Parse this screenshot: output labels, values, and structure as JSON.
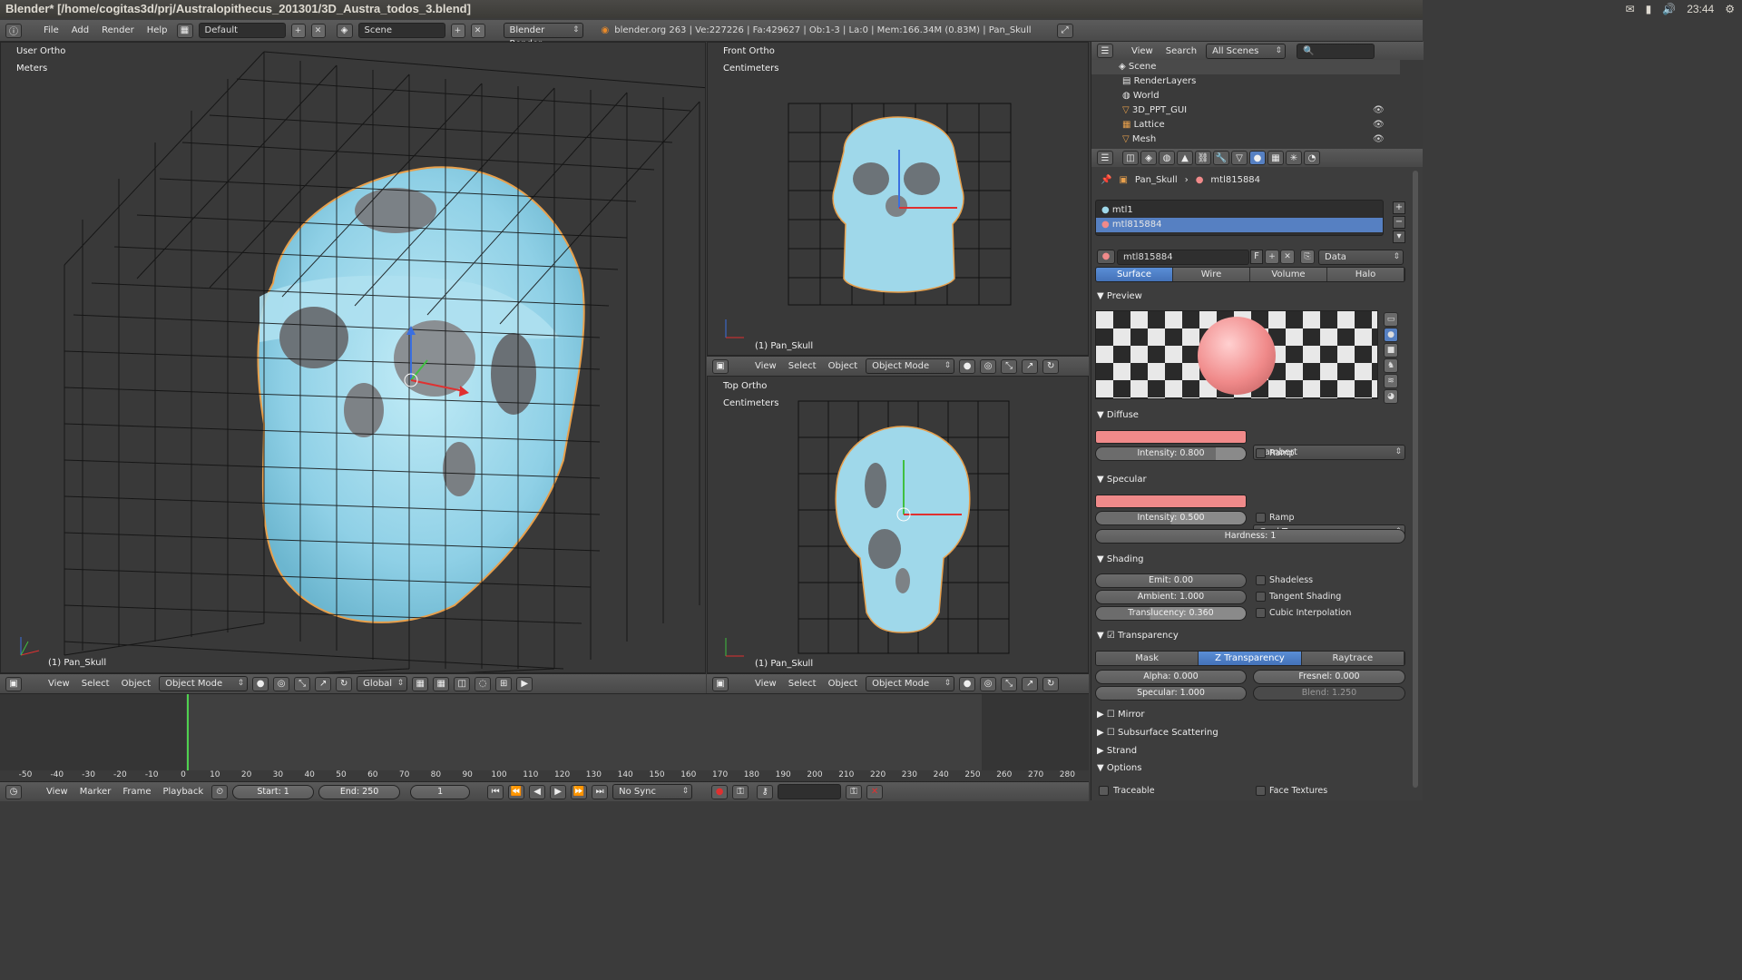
{
  "window": {
    "title": "Blender* [/home/cogitas3d/prj/Australopithecus_201301/3D_Austra_todos_3.blend]",
    "clock": "23:44"
  },
  "infobar": {
    "menus": [
      "File",
      "Add",
      "Render",
      "Help"
    ],
    "layout": "Default",
    "scene": "Scene",
    "engine": "Blender Render",
    "stats": "blender.org 263 | Ve:227226 | Fa:429627 | Ob:1-3 | La:0 | Mem:166.34M (0.83M) | Pan_Skull"
  },
  "viewport_main": {
    "view_name": "User Ortho",
    "units": "Meters",
    "object_label": "(1) Pan_Skull",
    "header": {
      "menus": [
        "View",
        "Select",
        "Object"
      ],
      "mode": "Object Mode",
      "orientation": "Global"
    }
  },
  "viewport_front": {
    "view_name": "Front Ortho",
    "units": "Centimeters",
    "object_label": "(1) Pan_Skull",
    "header": {
      "menus": [
        "View",
        "Select",
        "Object"
      ],
      "mode": "Object Mode"
    }
  },
  "viewport_top": {
    "view_name": "Top Ortho",
    "units": "Centimeters",
    "object_label": "(1) Pan_Skull",
    "header": {
      "menus": [
        "View",
        "Select",
        "Object"
      ],
      "mode": "Object Mode"
    }
  },
  "outliner": {
    "menus": [
      "View",
      "Search"
    ],
    "filter": "All Scenes",
    "items": [
      {
        "label": "Scene",
        "icon": "scene-icon"
      },
      {
        "label": "RenderLayers",
        "icon": "renderlayers-icon"
      },
      {
        "label": "World",
        "icon": "world-icon"
      },
      {
        "label": "3D_PPT_GUI",
        "icon": "mesh-object-icon"
      },
      {
        "label": "Lattice",
        "icon": "lattice-icon"
      },
      {
        "label": "Mesh",
        "icon": "mesh-object-icon"
      }
    ]
  },
  "properties": {
    "breadcrumb": [
      "Pan_Skull",
      "mtl815884"
    ],
    "materials": [
      "mtl1",
      "mtl815884"
    ],
    "material_name": "mtl815884",
    "material_flag": "F",
    "link": "Data",
    "type_tabs": [
      "Surface",
      "Wire",
      "Volume",
      "Halo"
    ],
    "active_type": "Surface",
    "preview": {
      "title": "Preview"
    },
    "diffuse": {
      "title": "Diffuse",
      "color": "#f08a8a",
      "shader": "Lambert",
      "intensity": "Intensity: 0.800",
      "ramp": "Ramp"
    },
    "specular": {
      "title": "Specular",
      "color": "#f08a8a",
      "shader": "CookTorr",
      "intensity": "Intensity: 0.500",
      "ramp": "Ramp",
      "hardness": "Hardness: 1"
    },
    "shading": {
      "title": "Shading",
      "emit": "Emit: 0.00",
      "ambient": "Ambient: 1.000",
      "translucency": "Translucency: 0.360",
      "shadeless": "Shadeless",
      "tangent": "Tangent Shading",
      "cubic": "Cubic Interpolation"
    },
    "transparency": {
      "title": "Transparency",
      "tabs": [
        "Mask",
        "Z Transparency",
        "Raytrace"
      ],
      "active": "Z Transparency",
      "alpha": "Alpha: 0.000",
      "fresnel": "Fresnel: 0.000",
      "specular": "Specular: 1.000",
      "blend": "Blend: 1.250"
    },
    "collapsed_panels": [
      "Mirror",
      "Subsurface Scattering",
      "Strand",
      "Options"
    ],
    "options": {
      "traceable": "Traceable",
      "face_textures": "Face Textures"
    }
  },
  "timeline": {
    "ticks": [
      "-50",
      "-40",
      "-30",
      "-20",
      "-10",
      "0",
      "10",
      "20",
      "30",
      "40",
      "50",
      "60",
      "70",
      "80",
      "90",
      "100",
      "110",
      "120",
      "130",
      "140",
      "150",
      "160",
      "170",
      "180",
      "190",
      "200",
      "210",
      "220",
      "230",
      "240",
      "250",
      "260",
      "270",
      "280"
    ],
    "menus": [
      "View",
      "Marker",
      "Frame",
      "Playback"
    ],
    "start": "Start: 1",
    "end": "End: 250",
    "current": "1",
    "sync": "No Sync"
  },
  "colors": {
    "skull": "#9fd8ea",
    "accent_blue": "#5680c2",
    "current_frame": "#4fd24f"
  }
}
